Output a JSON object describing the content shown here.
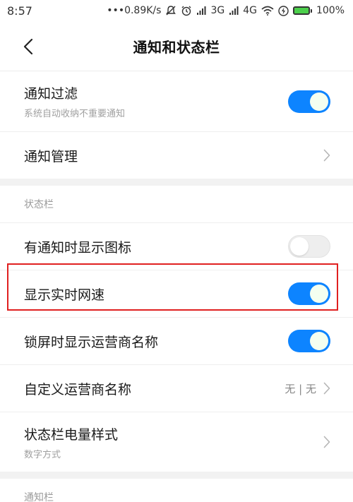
{
  "status_bar": {
    "time": "8:57",
    "net_speed": "•••0.89K/s",
    "network_3g": "3G",
    "network_4g": "4G",
    "battery_percent": "100%",
    "battery_level": 1.0,
    "icons": [
      "mute-icon",
      "alarm-icon",
      "signal-icon",
      "signal-icon",
      "wifi-icon",
      "charging-icon",
      "battery-icon"
    ]
  },
  "header": {
    "title": "通知和状态栏",
    "back_icon": "chevron-left-icon"
  },
  "notification_group": {
    "items": [
      {
        "title": "通知过滤",
        "subtitle": "系统自动收纳不重要通知",
        "control": "toggle",
        "on": true
      },
      {
        "title": "通知管理",
        "control": "chevron"
      }
    ]
  },
  "status_bar_section": {
    "label": "状态栏",
    "items": [
      {
        "title": "有通知时显示图标",
        "control": "toggle",
        "on": false
      },
      {
        "title": "显示实时网速",
        "control": "toggle",
        "on": true
      },
      {
        "title": "锁屏时显示运营商名称",
        "control": "toggle",
        "on": true
      },
      {
        "title": "自定义运营商名称",
        "value": "无 | 无",
        "control": "chevron"
      },
      {
        "title": "状态栏电量样式",
        "subtitle": "数字方式",
        "control": "chevron"
      }
    ]
  },
  "notification_bar_section": {
    "label": "通知栏"
  },
  "colors": {
    "toggle_on": "#0d84ff",
    "toggle_off": "#eeeeee",
    "highlight": "#e02020"
  }
}
